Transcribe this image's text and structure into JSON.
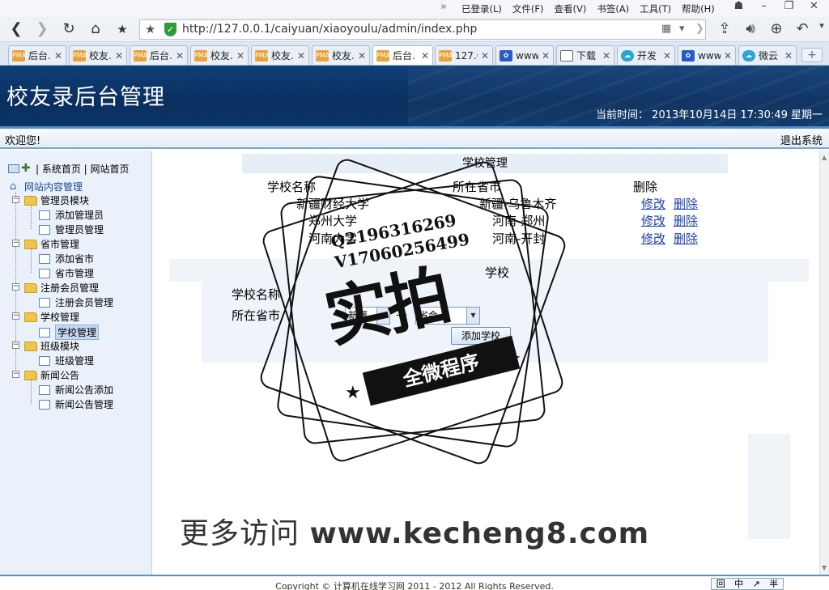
{
  "browser": {
    "menus": [
      "已登录(L)",
      "文件(F)",
      "查看(V)",
      "书签(A)",
      "工具(T)",
      "帮助(H)"
    ],
    "url": "http://127.0.0.1/caiyuan/xiaoyoulu/admin/index.php",
    "tabs": [
      {
        "label": "后台.",
        "icon": "pma"
      },
      {
        "label": "校友.",
        "icon": "pma"
      },
      {
        "label": "后台.",
        "icon": "pma"
      },
      {
        "label": "校友.",
        "icon": "pma"
      },
      {
        "label": "校友.",
        "icon": "pma"
      },
      {
        "label": "校友.",
        "icon": "pma"
      },
      {
        "label": "后台.",
        "icon": "pma",
        "active": true
      },
      {
        "label": "127.0",
        "icon": "pma"
      },
      {
        "label": "www",
        "icon": "paw"
      },
      {
        "label": "下载",
        "icon": "doc"
      },
      {
        "label": "开发",
        "icon": "cloud"
      },
      {
        "label": "www",
        "icon": "paw"
      },
      {
        "label": "微云",
        "icon": "cloud"
      }
    ]
  },
  "header": {
    "title": "校友录后台管理",
    "time": "当前时间： 2013年10月14日 17:30:49 星期一"
  },
  "welcome": {
    "left": "欢迎您!",
    "logout": "退出系统"
  },
  "sidebar": {
    "toplinks": "| 系统首页 | 网站首页",
    "root": "网站内容管理",
    "groups": [
      {
        "label": "管理员模块",
        "items": [
          "添加管理员",
          "管理员管理"
        ]
      },
      {
        "label": "省市管理",
        "items": [
          "添加省市",
          "省市管理"
        ]
      },
      {
        "label": "注册会员管理",
        "items": [
          "注册会员管理"
        ]
      },
      {
        "label": "学校管理",
        "items": [
          "学校管理"
        ]
      },
      {
        "label": "班级模块",
        "items": [
          "班级管理"
        ]
      },
      {
        "label": "新闻公告",
        "items": [
          "新闻公告添加",
          "新闻公告管理"
        ]
      }
    ]
  },
  "main": {
    "caption": "学校管理",
    "headers": [
      "学校名称",
      "所在省市",
      "删除"
    ],
    "rows": [
      {
        "name": "新疆财经大学",
        "city": "新疆-乌鲁木齐",
        "edit": "修改",
        "del": "删除"
      },
      {
        "name": "郑州大学",
        "city": "河南-郑州",
        "edit": "修改",
        "del": "删除"
      },
      {
        "name": "河南大学",
        "city": "河南-开封",
        "edit": "修改",
        "del": "删除"
      }
    ],
    "form": {
      "title": "学校",
      "name_label": "学校名称",
      "city_label": "所在省市",
      "province_value": "新疆",
      "city_value": "省会",
      "sep": "->",
      "submit": "添加学校"
    }
  },
  "footer": {
    "copyright": "Copyright © 计算机在线学习网 2011 - 2012 All Rights Reserved.",
    "ime": [
      "回",
      "中",
      "↗",
      "半"
    ]
  },
  "watermark": {
    "qq": "Q2196316269",
    "v": "V17060256499",
    "big": "实拍",
    "ribbon": "全微程序",
    "site_cn": "更多访问",
    "site_en": "www.kecheng8.com"
  }
}
